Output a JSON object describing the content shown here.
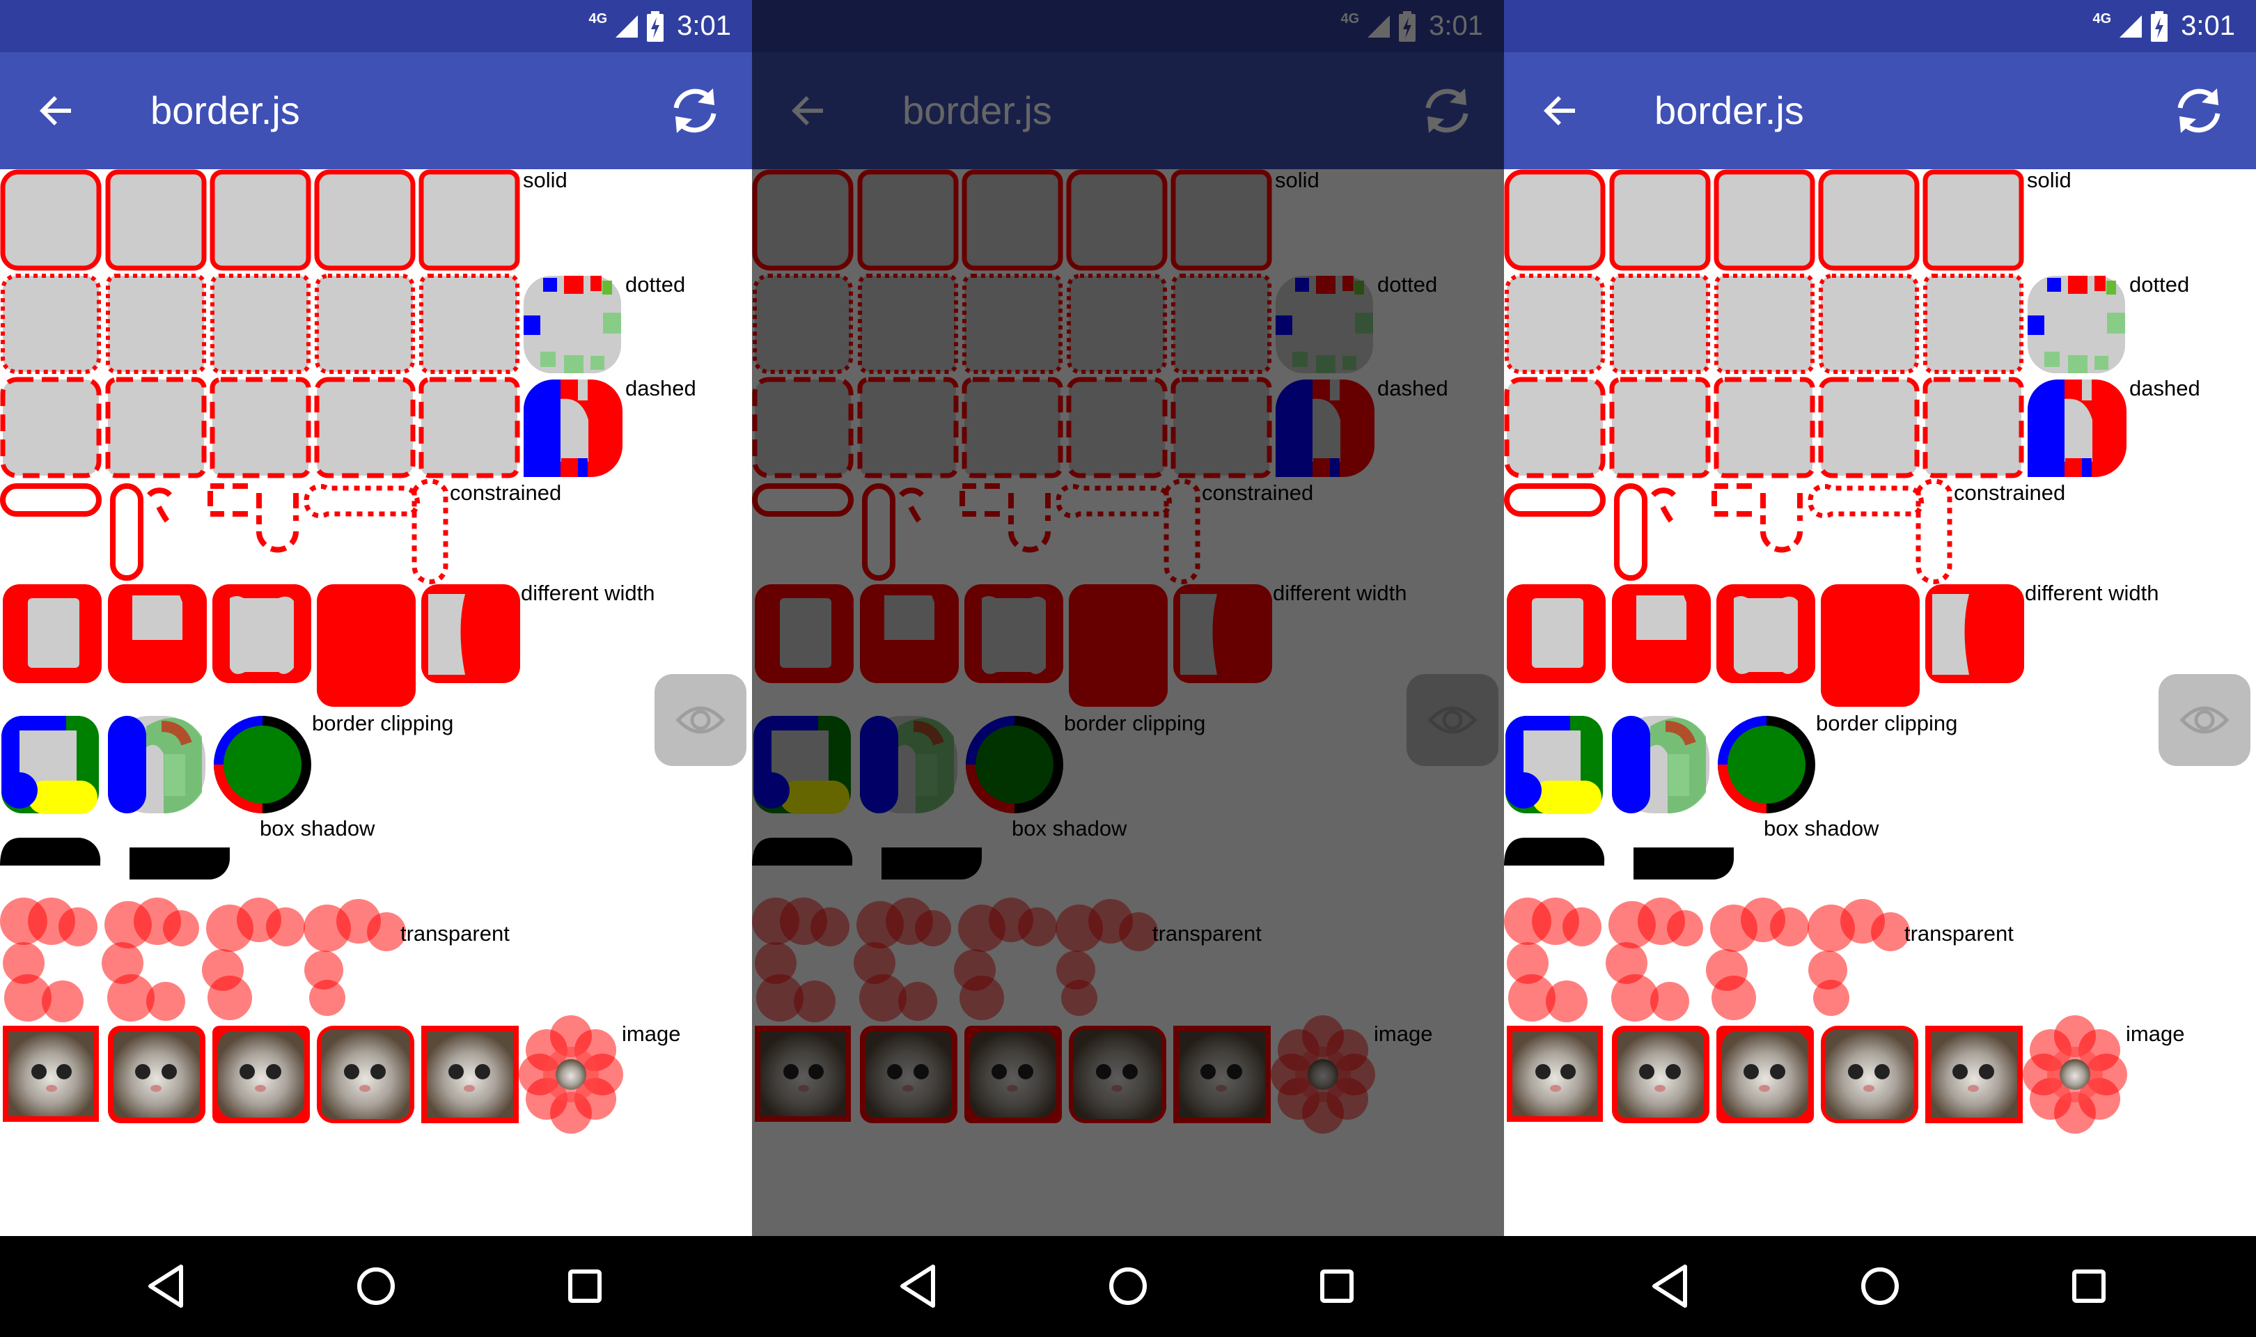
{
  "status": {
    "network": "4G",
    "time": "3:01"
  },
  "appbar": {
    "title": "border.js"
  },
  "labels": {
    "solid": "solid",
    "dotted": "dotted",
    "dashed": "dashed",
    "constrained": "constrained",
    "different_width": "different width",
    "border_clipping": "border clipping",
    "box_shadow": "box shadow",
    "transparent": "transparent",
    "image": "image"
  },
  "colors": {
    "primary_dark": "#303f9f",
    "primary": "#3f51b5",
    "border_red": "#ff0000",
    "fill_gray": "#cccccc",
    "clip_blue": "#0000ff",
    "clip_green": "#008000",
    "clip_yellow": "#ffff00"
  },
  "icons": {
    "back": "arrow-left",
    "reload": "refresh",
    "inspect": "eye",
    "nav_back": "triangle-left",
    "nav_home": "circle",
    "nav_recents": "square"
  },
  "panels": [
    {
      "id": "left",
      "dimmed": false
    },
    {
      "id": "middle",
      "dimmed": true
    },
    {
      "id": "right",
      "dimmed": false
    }
  ]
}
